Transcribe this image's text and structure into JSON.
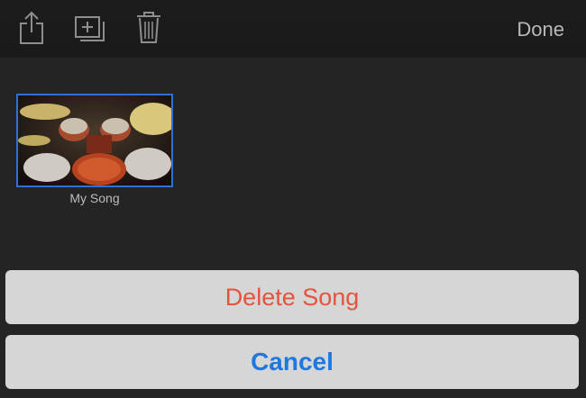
{
  "toolbar": {
    "share_icon": "share-icon",
    "duplicate_icon": "duplicate-icon",
    "trash_icon": "trash-icon",
    "done_label": "Done"
  },
  "songs": [
    {
      "title": "My Song",
      "thumbnail": "drum-kit-image",
      "selected": true
    }
  ],
  "action_sheet": {
    "delete_label": "Delete Song",
    "cancel_label": "Cancel",
    "colors": {
      "destructive": "#e5533e",
      "default": "#1f78e0"
    }
  }
}
